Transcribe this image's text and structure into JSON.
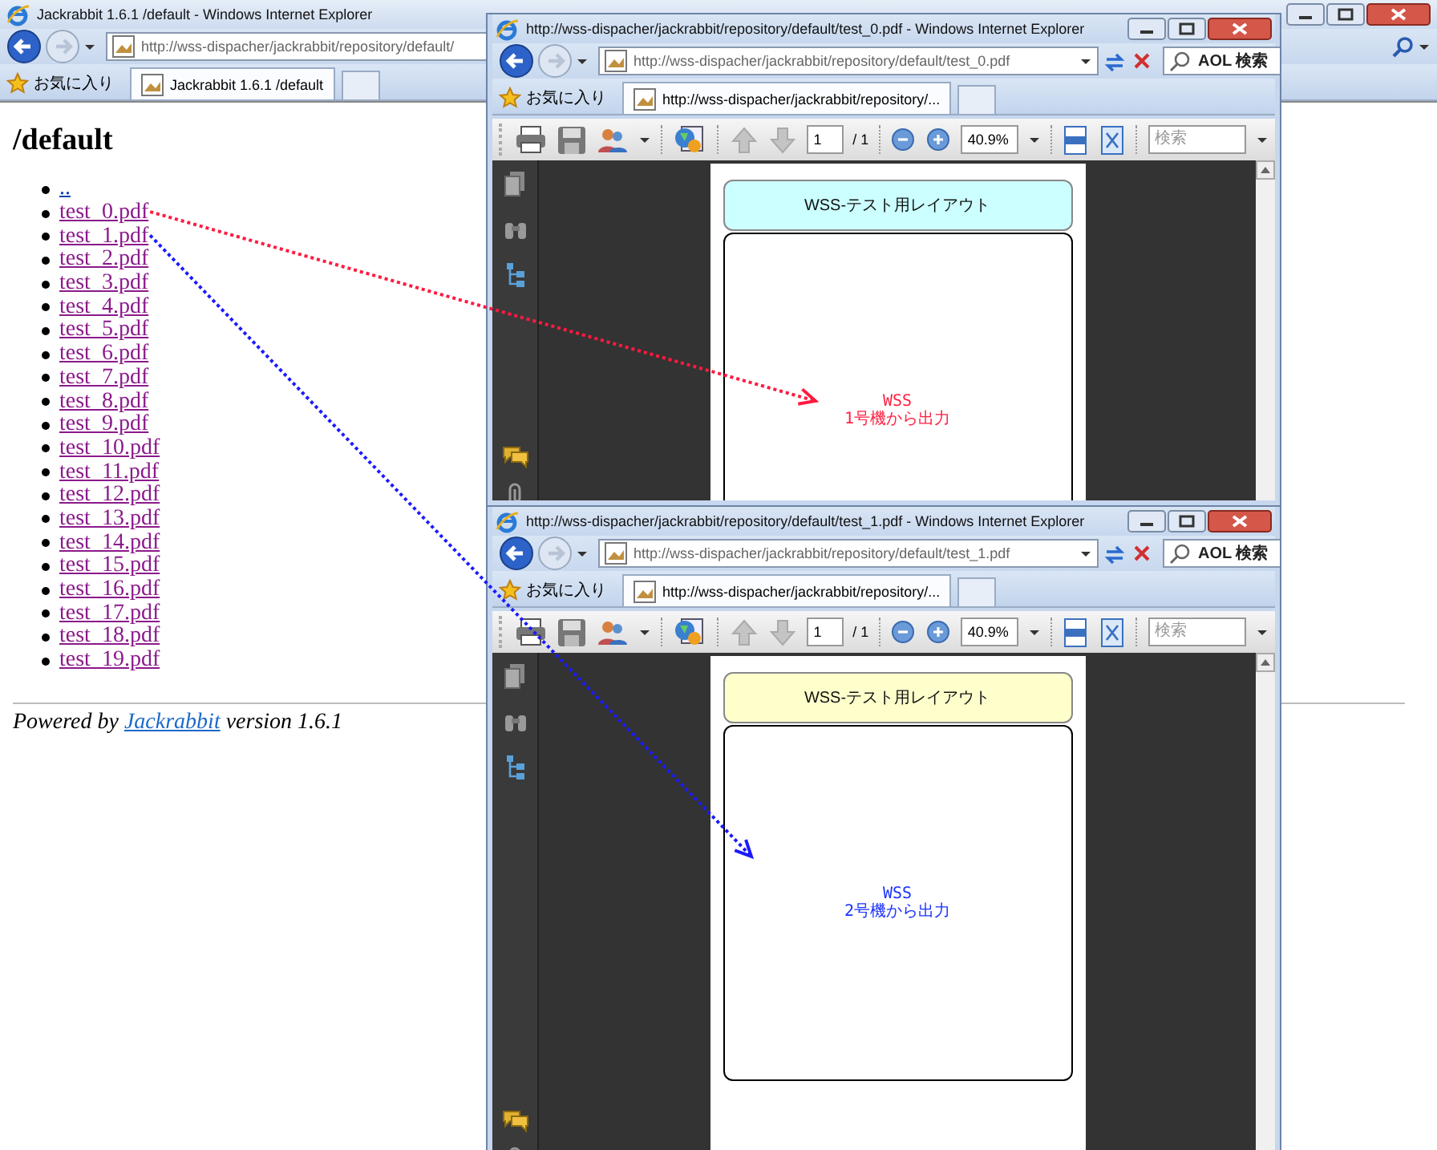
{
  "main_window": {
    "title": "Jackrabbit 1.6.1 /default - Windows Internet Explorer",
    "address": "http://wss-dispacher/jackrabbit/repository/default/",
    "favorites": "お気に入り",
    "tabs": [
      {
        "label": "Jackrabbit 1.6.1 /default",
        "selected": true
      }
    ],
    "page": {
      "heading": "/default",
      "links": [
        {
          "label": "..",
          "visited": false
        },
        {
          "label": "test_0.pdf",
          "visited": true
        },
        {
          "label": "test_1.pdf",
          "visited": true
        },
        {
          "label": "test_2.pdf",
          "visited": true
        },
        {
          "label": "test_3.pdf",
          "visited": true
        },
        {
          "label": "test_4.pdf",
          "visited": true
        },
        {
          "label": "test_5.pdf",
          "visited": true
        },
        {
          "label": "test_6.pdf",
          "visited": true
        },
        {
          "label": "test_7.pdf",
          "visited": true
        },
        {
          "label": "test_8.pdf",
          "visited": true
        },
        {
          "label": "test_9.pdf",
          "visited": true
        },
        {
          "label": "test_10.pdf",
          "visited": true
        },
        {
          "label": "test_11.pdf",
          "visited": true
        },
        {
          "label": "test_12.pdf",
          "visited": true
        },
        {
          "label": "test_13.pdf",
          "visited": true
        },
        {
          "label": "test_14.pdf",
          "visited": true
        },
        {
          "label": "test_15.pdf",
          "visited": true
        },
        {
          "label": "test_16.pdf",
          "visited": true
        },
        {
          "label": "test_17.pdf",
          "visited": true
        },
        {
          "label": "test_18.pdf",
          "visited": true
        },
        {
          "label": "test_19.pdf",
          "visited": true
        }
      ],
      "footer": {
        "prefix": "Powered by",
        "link": "Jackrabbit",
        "suffix": "version 1.6.1"
      }
    }
  },
  "pdf_windows": [
    {
      "title": "http://wss-dispacher/jackrabbit/repository/default/test_0.pdf - Windows Internet Explorer",
      "address": "http://wss-dispacher/jackrabbit/repository/default/test_0.pdf",
      "search_placeholder": "AOL 検索",
      "favorites": "お気に入り",
      "tab": "http://wss-dispacher/jackrabbit/repository/...",
      "page_number": "1",
      "page_total": "/ 1",
      "zoom": "40.9%",
      "find_placeholder": "検索",
      "document": {
        "header": {
          "text": "WSS-テスト用レイアウト",
          "color": "#ccffff"
        },
        "message": {
          "lines": [
            "WSS",
            "1号機から出力"
          ],
          "color": "#ff2244"
        }
      }
    },
    {
      "title": "http://wss-dispacher/jackrabbit/repository/default/test_1.pdf - Windows Internet Explorer",
      "address": "http://wss-dispacher/jackrabbit/repository/default/test_1.pdf",
      "search_placeholder": "AOL 検索",
      "favorites": "お気に入り",
      "tab": "http://wss-dispacher/jackrabbit/repository/...",
      "page_number": "1",
      "page_total": "/ 1",
      "zoom": "40.9%",
      "find_placeholder": "検索",
      "document": {
        "header": {
          "text": "WSS-テスト用レイアウト",
          "color": "#ffffcc"
        },
        "message": {
          "lines": [
            "WSS",
            "2号機から出力"
          ],
          "color": "#1a33ff"
        }
      }
    }
  ],
  "arrows": [
    {
      "color": "#ff1a40"
    },
    {
      "color": "#1a1aff"
    }
  ]
}
